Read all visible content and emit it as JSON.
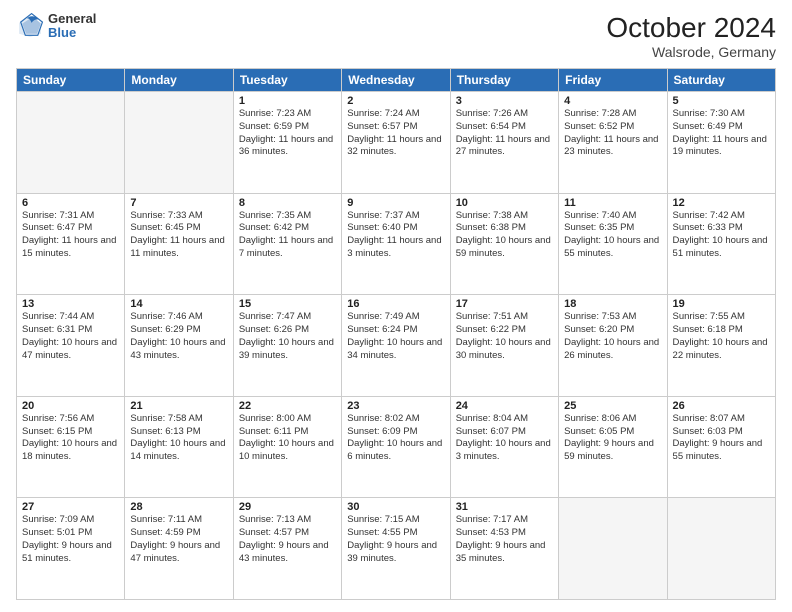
{
  "header": {
    "logo_general": "General",
    "logo_blue": "Blue",
    "month": "October 2024",
    "location": "Walsrode, Germany"
  },
  "days_of_week": [
    "Sunday",
    "Monday",
    "Tuesday",
    "Wednesday",
    "Thursday",
    "Friday",
    "Saturday"
  ],
  "weeks": [
    [
      {
        "day": "",
        "info": ""
      },
      {
        "day": "",
        "info": ""
      },
      {
        "day": "1",
        "info": "Sunrise: 7:23 AM\nSunset: 6:59 PM\nDaylight: 11 hours and 36 minutes."
      },
      {
        "day": "2",
        "info": "Sunrise: 7:24 AM\nSunset: 6:57 PM\nDaylight: 11 hours and 32 minutes."
      },
      {
        "day": "3",
        "info": "Sunrise: 7:26 AM\nSunset: 6:54 PM\nDaylight: 11 hours and 27 minutes."
      },
      {
        "day": "4",
        "info": "Sunrise: 7:28 AM\nSunset: 6:52 PM\nDaylight: 11 hours and 23 minutes."
      },
      {
        "day": "5",
        "info": "Sunrise: 7:30 AM\nSunset: 6:49 PM\nDaylight: 11 hours and 19 minutes."
      }
    ],
    [
      {
        "day": "6",
        "info": "Sunrise: 7:31 AM\nSunset: 6:47 PM\nDaylight: 11 hours and 15 minutes."
      },
      {
        "day": "7",
        "info": "Sunrise: 7:33 AM\nSunset: 6:45 PM\nDaylight: 11 hours and 11 minutes."
      },
      {
        "day": "8",
        "info": "Sunrise: 7:35 AM\nSunset: 6:42 PM\nDaylight: 11 hours and 7 minutes."
      },
      {
        "day": "9",
        "info": "Sunrise: 7:37 AM\nSunset: 6:40 PM\nDaylight: 11 hours and 3 minutes."
      },
      {
        "day": "10",
        "info": "Sunrise: 7:38 AM\nSunset: 6:38 PM\nDaylight: 10 hours and 59 minutes."
      },
      {
        "day": "11",
        "info": "Sunrise: 7:40 AM\nSunset: 6:35 PM\nDaylight: 10 hours and 55 minutes."
      },
      {
        "day": "12",
        "info": "Sunrise: 7:42 AM\nSunset: 6:33 PM\nDaylight: 10 hours and 51 minutes."
      }
    ],
    [
      {
        "day": "13",
        "info": "Sunrise: 7:44 AM\nSunset: 6:31 PM\nDaylight: 10 hours and 47 minutes."
      },
      {
        "day": "14",
        "info": "Sunrise: 7:46 AM\nSunset: 6:29 PM\nDaylight: 10 hours and 43 minutes."
      },
      {
        "day": "15",
        "info": "Sunrise: 7:47 AM\nSunset: 6:26 PM\nDaylight: 10 hours and 39 minutes."
      },
      {
        "day": "16",
        "info": "Sunrise: 7:49 AM\nSunset: 6:24 PM\nDaylight: 10 hours and 34 minutes."
      },
      {
        "day": "17",
        "info": "Sunrise: 7:51 AM\nSunset: 6:22 PM\nDaylight: 10 hours and 30 minutes."
      },
      {
        "day": "18",
        "info": "Sunrise: 7:53 AM\nSunset: 6:20 PM\nDaylight: 10 hours and 26 minutes."
      },
      {
        "day": "19",
        "info": "Sunrise: 7:55 AM\nSunset: 6:18 PM\nDaylight: 10 hours and 22 minutes."
      }
    ],
    [
      {
        "day": "20",
        "info": "Sunrise: 7:56 AM\nSunset: 6:15 PM\nDaylight: 10 hours and 18 minutes."
      },
      {
        "day": "21",
        "info": "Sunrise: 7:58 AM\nSunset: 6:13 PM\nDaylight: 10 hours and 14 minutes."
      },
      {
        "day": "22",
        "info": "Sunrise: 8:00 AM\nSunset: 6:11 PM\nDaylight: 10 hours and 10 minutes."
      },
      {
        "day": "23",
        "info": "Sunrise: 8:02 AM\nSunset: 6:09 PM\nDaylight: 10 hours and 6 minutes."
      },
      {
        "day": "24",
        "info": "Sunrise: 8:04 AM\nSunset: 6:07 PM\nDaylight: 10 hours and 3 minutes."
      },
      {
        "day": "25",
        "info": "Sunrise: 8:06 AM\nSunset: 6:05 PM\nDaylight: 9 hours and 59 minutes."
      },
      {
        "day": "26",
        "info": "Sunrise: 8:07 AM\nSunset: 6:03 PM\nDaylight: 9 hours and 55 minutes."
      }
    ],
    [
      {
        "day": "27",
        "info": "Sunrise: 7:09 AM\nSunset: 5:01 PM\nDaylight: 9 hours and 51 minutes."
      },
      {
        "day": "28",
        "info": "Sunrise: 7:11 AM\nSunset: 4:59 PM\nDaylight: 9 hours and 47 minutes."
      },
      {
        "day": "29",
        "info": "Sunrise: 7:13 AM\nSunset: 4:57 PM\nDaylight: 9 hours and 43 minutes."
      },
      {
        "day": "30",
        "info": "Sunrise: 7:15 AM\nSunset: 4:55 PM\nDaylight: 9 hours and 39 minutes."
      },
      {
        "day": "31",
        "info": "Sunrise: 7:17 AM\nSunset: 4:53 PM\nDaylight: 9 hours and 35 minutes."
      },
      {
        "day": "",
        "info": ""
      },
      {
        "day": "",
        "info": ""
      }
    ]
  ]
}
